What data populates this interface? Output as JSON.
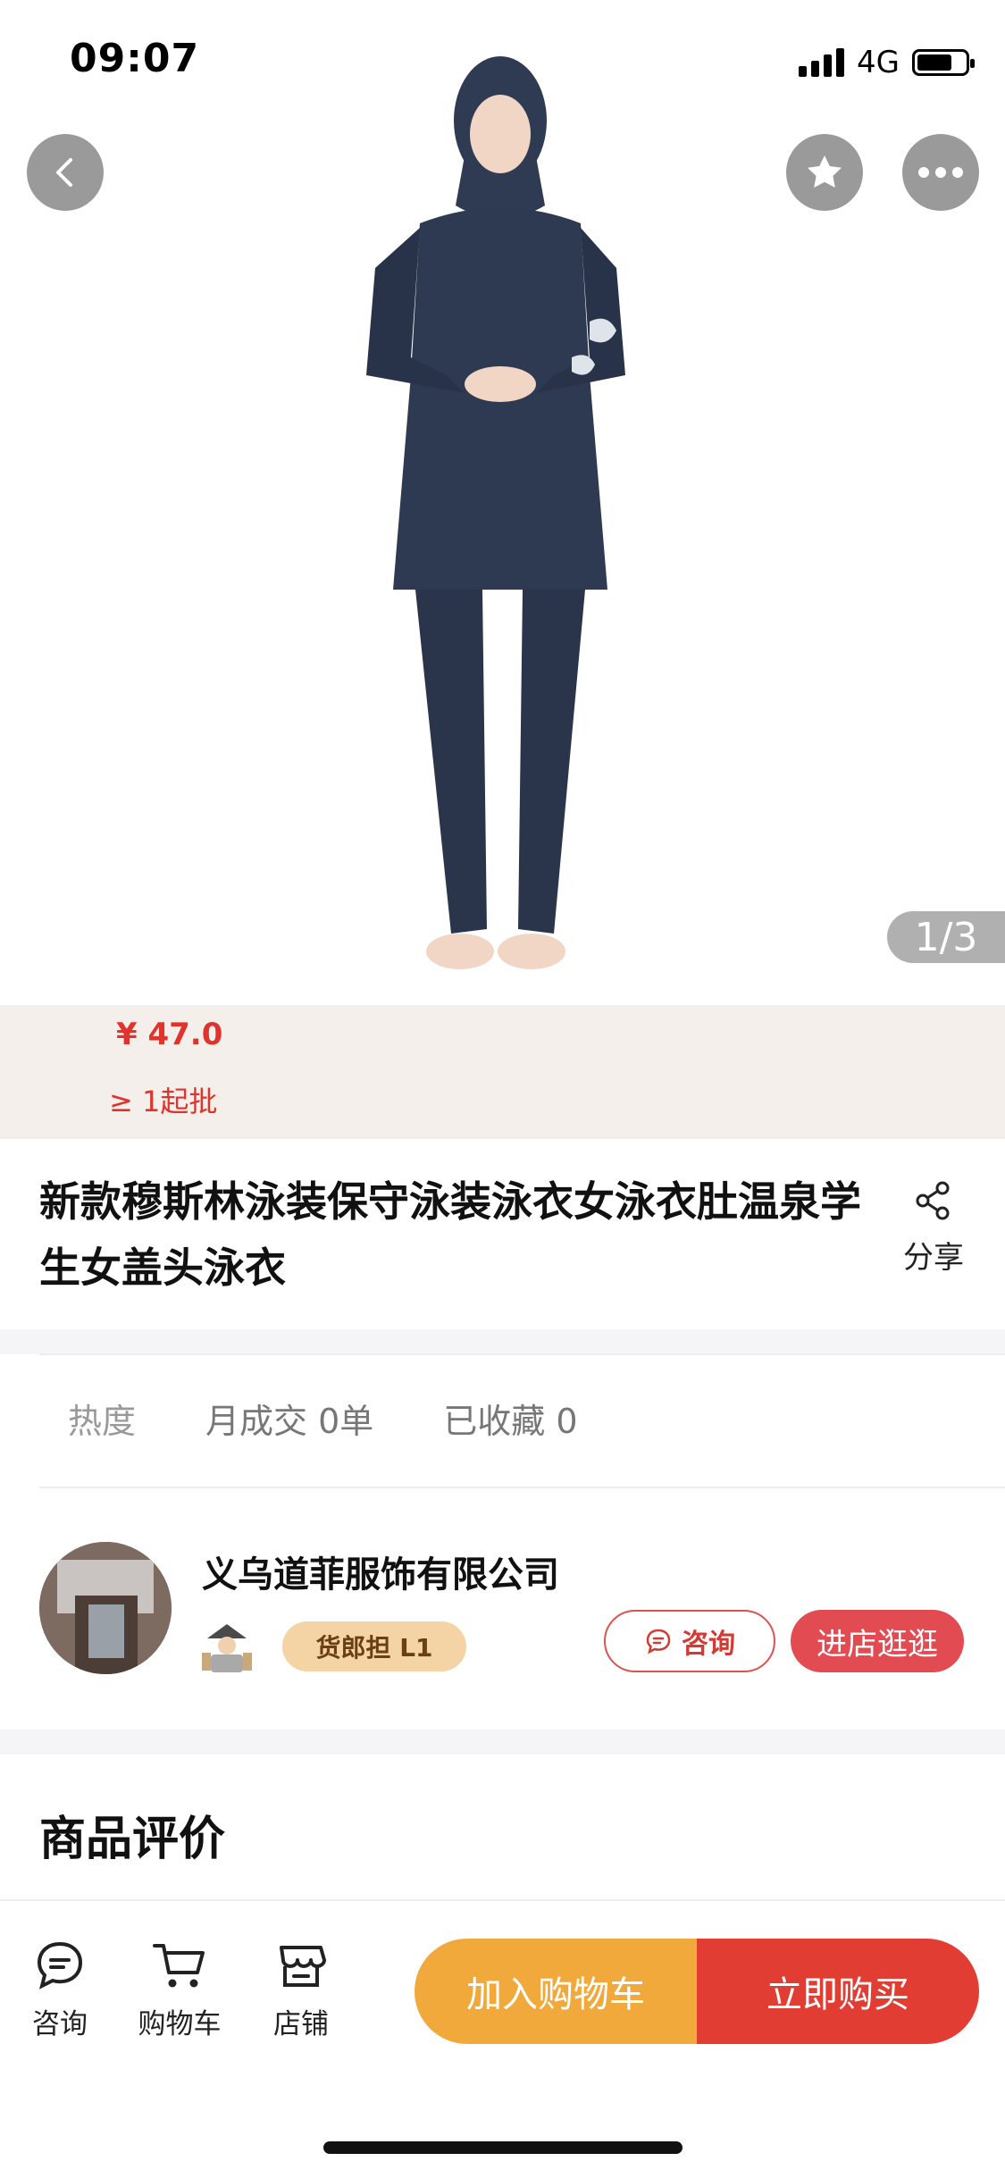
{
  "status_bar": {
    "time": "09:07",
    "network": "4G"
  },
  "gallery": {
    "pager": "1/3"
  },
  "product": {
    "price": "¥ 47.0",
    "moq": "≥ 1起批",
    "title": "新款穆斯林泳装保守泳装泳衣女泳衣肚温泉学生女盖头泳衣",
    "share_label": "分享"
  },
  "stats": {
    "heat": "热度",
    "monthly_deals": "月成交 0单",
    "favorited": "已收藏 0"
  },
  "shop": {
    "name": "义乌道菲服饰有限公司",
    "badge": "货郎担 L1",
    "consult_label": "咨询",
    "visit_label": "进店逛逛"
  },
  "reviews": {
    "title": "商品评价"
  },
  "bottom_nav": {
    "consult": "咨询",
    "cart": "购物车",
    "store": "店铺",
    "add_to_cart": "加入购物车",
    "buy_now": "立即购买"
  },
  "colors": {
    "accent_red": "#e23d33",
    "accent_orange": "#f2a93b",
    "price_red": "#e0332c"
  }
}
